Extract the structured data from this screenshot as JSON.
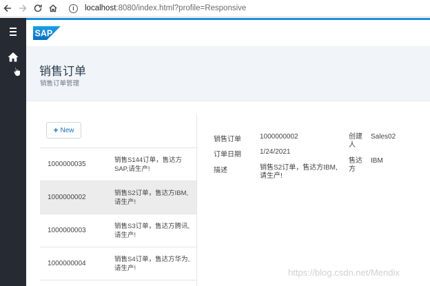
{
  "browser": {
    "url_host": "localhost",
    "url_path": ":8080/index.html?profile=Responsive"
  },
  "brand": {
    "logo_text": "SAP",
    "accent": "#1b8ed6"
  },
  "header": {
    "title": "销售订单",
    "subtitle": "销售订单管理"
  },
  "list": {
    "new_label": "New",
    "rows": [
      {
        "number": "1000000035",
        "description": "销售S144订单，售达方SAP,请生产!"
      },
      {
        "number": "1000000002",
        "description": "销售S2订单，售达方IBM,请生产!"
      },
      {
        "number": "1000000003",
        "description": "销售S3订单，售达方腾讯,请生产!"
      },
      {
        "number": "1000000004",
        "description": "销售S4订单，售达方华为,请生产!"
      }
    ]
  },
  "detail": {
    "order_label": "销售订单",
    "order_value": "1000000002",
    "date_label": "订单日期",
    "date_value": "1/24/2021",
    "desc_label": "描述",
    "desc_value": "销售S2订单，售达方IBM,请生产!",
    "creator_label": "创建人",
    "creator_value": "Sales02",
    "soldto_label": "售达方",
    "soldto_value": "IBM"
  },
  "watermark": "https://blog.csdn.net/Mendix"
}
